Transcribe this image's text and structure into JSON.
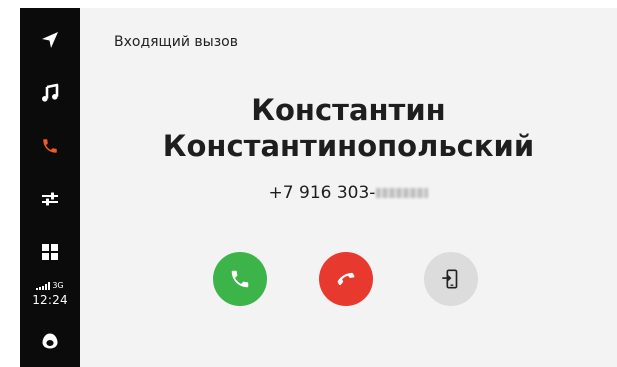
{
  "sidebar": {
    "items": [
      {
        "name": "navigation",
        "icon": "navigation-arrow-icon",
        "color": "#ffffff"
      },
      {
        "name": "music",
        "icon": "music-note-icon",
        "color": "#ffffff"
      },
      {
        "name": "phone",
        "icon": "phone-icon",
        "color": "#f05a28",
        "active": true
      },
      {
        "name": "settings",
        "icon": "sliders-icon",
        "color": "#ffffff"
      },
      {
        "name": "apps",
        "icon": "apps-grid-icon",
        "color": "#ffffff"
      },
      {
        "name": "assistant",
        "icon": "alice-assistant-icon",
        "color": "#ffffff"
      }
    ],
    "status": {
      "network": "3G",
      "time": "12:24"
    }
  },
  "call": {
    "header": "Входящий вызов",
    "caller_first_name": "Константин",
    "caller_last_name": "Константинопольский",
    "number_visible": "+7 916 303-",
    "number_masked": "33-04"
  },
  "buttons": {
    "answer": {
      "icon": "phone-answer-icon",
      "color": "#3cb44a"
    },
    "decline": {
      "icon": "phone-decline-icon",
      "color": "#e8392f"
    },
    "transfer": {
      "icon": "transfer-to-phone-icon",
      "color": "#dcdcdc"
    }
  },
  "colors": {
    "sidebar_bg": "#0b0b0b",
    "content_bg": "#f3f3f3",
    "accent": "#f05a28"
  }
}
